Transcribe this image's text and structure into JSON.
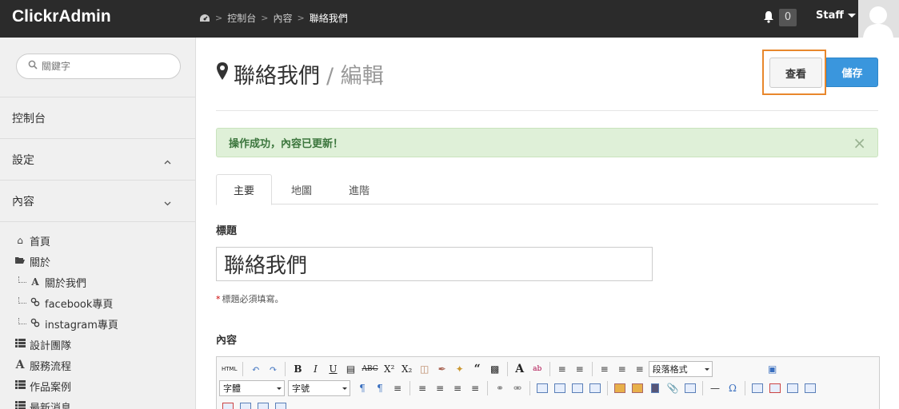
{
  "header": {
    "brand": "ClickrAdmin",
    "breadcrumb": [
      "控制台",
      "內容",
      "聯絡我們"
    ],
    "notification_count": "0",
    "user_label": "Staff"
  },
  "sidebar": {
    "search_placeholder": "關鍵字",
    "sections": [
      {
        "label": "控制台"
      },
      {
        "label": "設定"
      },
      {
        "label": "內容"
      }
    ],
    "tree": [
      {
        "label": "首頁",
        "icon": "home-icon"
      },
      {
        "label": "關於",
        "icon": "folder-open-icon"
      },
      {
        "label": "關於我們",
        "icon": "font-icon"
      },
      {
        "label": "facebook專頁",
        "icon": "link-icon"
      },
      {
        "label": "instagram專頁",
        "icon": "link-icon"
      },
      {
        "label": "設計團隊",
        "icon": "list-icon"
      },
      {
        "label": "服務流程",
        "icon": "font-icon"
      },
      {
        "label": "作品案例",
        "icon": "list-icon"
      },
      {
        "label": "最新消息",
        "icon": "list-icon"
      }
    ]
  },
  "main": {
    "title": "聯絡我們",
    "subtitle": "/ 編輯",
    "view_button": "查看",
    "save_button": "儲存",
    "alert": "操作成功，內容已更新！",
    "tabs": [
      "主要",
      "地圖",
      "進階"
    ],
    "title_label": "標題",
    "title_value": "聯絡我們",
    "title_help": "標題必須填寫。",
    "content_label": "內容"
  },
  "editor": {
    "format_label": "段落格式",
    "font_label": "字體",
    "size_label": "字號",
    "html_label": "HTML"
  },
  "colors": {
    "topbar": "#2b2b2b",
    "primary": "#3a96dd",
    "success_bg": "#dff0d8",
    "highlight": "#e8872c"
  }
}
